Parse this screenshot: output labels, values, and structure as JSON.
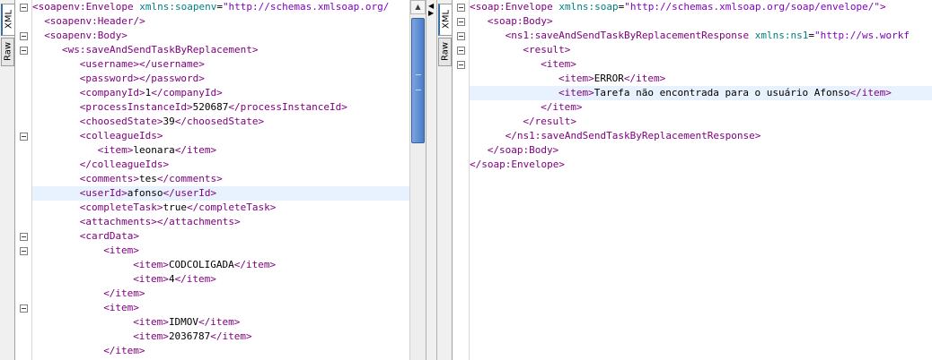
{
  "left_pane": {
    "tabs": {
      "xml": "XML",
      "raw": "Raw"
    },
    "lines": [
      {
        "indent": 0,
        "parts": [
          [
            "t",
            "<soapenv:Envelope "
          ],
          [
            "an",
            "xmlns:soapenv"
          ],
          [
            "tx",
            "="
          ],
          [
            "av",
            "\"http://schemas.xmlsoap.org/"
          ]
        ],
        "fold": true
      },
      {
        "indent": 2,
        "parts": [
          [
            "t",
            "<soapenv:Header/>"
          ]
        ]
      },
      {
        "indent": 2,
        "parts": [
          [
            "t",
            "<soapenv:Body>"
          ]
        ],
        "fold": true
      },
      {
        "indent": 5,
        "parts": [
          [
            "t",
            "<ws:saveAndSendTaskByReplacement>"
          ]
        ],
        "fold": true
      },
      {
        "indent": 8,
        "parts": [
          [
            "t",
            "<username>"
          ],
          [
            "t",
            "</username>"
          ]
        ]
      },
      {
        "indent": 8,
        "parts": [
          [
            "t",
            "<password>"
          ],
          [
            "t",
            "</password>"
          ]
        ]
      },
      {
        "indent": 8,
        "parts": [
          [
            "t",
            "<companyId>"
          ],
          [
            "tx",
            "1"
          ],
          [
            "t",
            "</companyId>"
          ]
        ]
      },
      {
        "indent": 8,
        "parts": [
          [
            "t",
            "<processInstanceId>"
          ],
          [
            "tx",
            "520687"
          ],
          [
            "t",
            "</processInstanceId>"
          ]
        ]
      },
      {
        "indent": 8,
        "parts": [
          [
            "t",
            "<choosedState>"
          ],
          [
            "tx",
            "39"
          ],
          [
            "t",
            "</choosedState>"
          ]
        ]
      },
      {
        "indent": 8,
        "parts": [
          [
            "t",
            "<colleagueIds>"
          ]
        ],
        "fold": true
      },
      {
        "indent": 11,
        "parts": [
          [
            "t",
            "<item>"
          ],
          [
            "tx",
            "leonara"
          ],
          [
            "t",
            "</item>"
          ]
        ]
      },
      {
        "indent": 8,
        "parts": [
          [
            "t",
            "</colleagueIds>"
          ]
        ]
      },
      {
        "indent": 8,
        "parts": [
          [
            "t",
            "<comments>"
          ],
          [
            "tx",
            "tes"
          ],
          [
            "t",
            "</comments>"
          ]
        ]
      },
      {
        "indent": 8,
        "parts": [
          [
            "t",
            "<userId>"
          ],
          [
            "tx",
            "afonso"
          ],
          [
            "t",
            "</userId>"
          ]
        ],
        "hl": true
      },
      {
        "indent": 8,
        "parts": [
          [
            "t",
            "<completeTask>"
          ],
          [
            "tx",
            "true"
          ],
          [
            "t",
            "</completeTask>"
          ]
        ]
      },
      {
        "indent": 8,
        "parts": [
          [
            "t",
            "<attachments>"
          ],
          [
            "t",
            "</attachments>"
          ]
        ]
      },
      {
        "indent": 8,
        "parts": [
          [
            "t",
            "<cardData>"
          ]
        ],
        "fold": true
      },
      {
        "indent": 12,
        "parts": [
          [
            "t",
            "<item>"
          ]
        ],
        "fold": true
      },
      {
        "indent": 17,
        "parts": [
          [
            "t",
            "<item>"
          ],
          [
            "tx",
            "CODCOLIGADA"
          ],
          [
            "t",
            "</item>"
          ]
        ]
      },
      {
        "indent": 17,
        "parts": [
          [
            "t",
            "<item>"
          ],
          [
            "tx",
            "4"
          ],
          [
            "t",
            "</item>"
          ]
        ]
      },
      {
        "indent": 12,
        "parts": [
          [
            "t",
            "</item>"
          ]
        ]
      },
      {
        "indent": 12,
        "parts": [
          [
            "t",
            "<item>"
          ]
        ],
        "fold": true
      },
      {
        "indent": 17,
        "parts": [
          [
            "t",
            "<item>"
          ],
          [
            "tx",
            "IDMOV"
          ],
          [
            "t",
            "</item>"
          ]
        ]
      },
      {
        "indent": 17,
        "parts": [
          [
            "t",
            "<item>"
          ],
          [
            "tx",
            "2036787"
          ],
          [
            "t",
            "</item>"
          ]
        ]
      },
      {
        "indent": 12,
        "parts": [
          [
            "t",
            "</item>"
          ]
        ]
      }
    ]
  },
  "right_pane": {
    "tabs": {
      "xml": "XML",
      "raw": "Raw"
    },
    "lines": [
      {
        "indent": 0,
        "parts": [
          [
            "t",
            "<soap:Envelope "
          ],
          [
            "an",
            "xmlns:soap"
          ],
          [
            "tx",
            "="
          ],
          [
            "av",
            "\"http://schemas.xmlsoap.org/soap/envelope/\""
          ],
          [
            "t",
            ">"
          ]
        ],
        "fold": true
      },
      {
        "indent": 3,
        "parts": [
          [
            "t",
            "<soap:Body>"
          ]
        ],
        "fold": true
      },
      {
        "indent": 6,
        "parts": [
          [
            "t",
            "<ns1:saveAndSendTaskByReplacementResponse "
          ],
          [
            "an",
            "xmlns:ns1"
          ],
          [
            "tx",
            "="
          ],
          [
            "av",
            "\"http://ws.workf"
          ]
        ],
        "fold": true
      },
      {
        "indent": 9,
        "parts": [
          [
            "t",
            "<result>"
          ]
        ],
        "fold": true
      },
      {
        "indent": 12,
        "parts": [
          [
            "t",
            "<item>"
          ]
        ],
        "fold": true
      },
      {
        "indent": 15,
        "parts": [
          [
            "t",
            "<item>"
          ],
          [
            "tx",
            "ERROR"
          ],
          [
            "t",
            "</item>"
          ]
        ]
      },
      {
        "indent": 15,
        "parts": [
          [
            "t",
            "<item>"
          ],
          [
            "tx",
            "Tarefa não encontrada para o usuário Afonso"
          ],
          [
            "t",
            "</item>"
          ]
        ],
        "hl": true
      },
      {
        "indent": 12,
        "parts": [
          [
            "t",
            "</item>"
          ]
        ]
      },
      {
        "indent": 9,
        "parts": [
          [
            "t",
            "</result>"
          ]
        ]
      },
      {
        "indent": 6,
        "parts": [
          [
            "t",
            "</ns1:saveAndSendTaskByReplacementResponse>"
          ]
        ]
      },
      {
        "indent": 3,
        "parts": [
          [
            "t",
            "</soap:Body>"
          ]
        ]
      },
      {
        "indent": 0,
        "parts": [
          [
            "t",
            "</soap:Envelope>"
          ]
        ]
      }
    ]
  },
  "colors": {
    "tag": "#800080",
    "attr_name": "#008080",
    "attr_value": "#8000c0",
    "highlight": "#e8f2fe"
  },
  "icons": {
    "fold": "minus-box-icon",
    "scroll_up": "arrow-up-icon",
    "scroll_down": "arrow-down-icon",
    "splitter": "collapse-arrows-icon"
  }
}
